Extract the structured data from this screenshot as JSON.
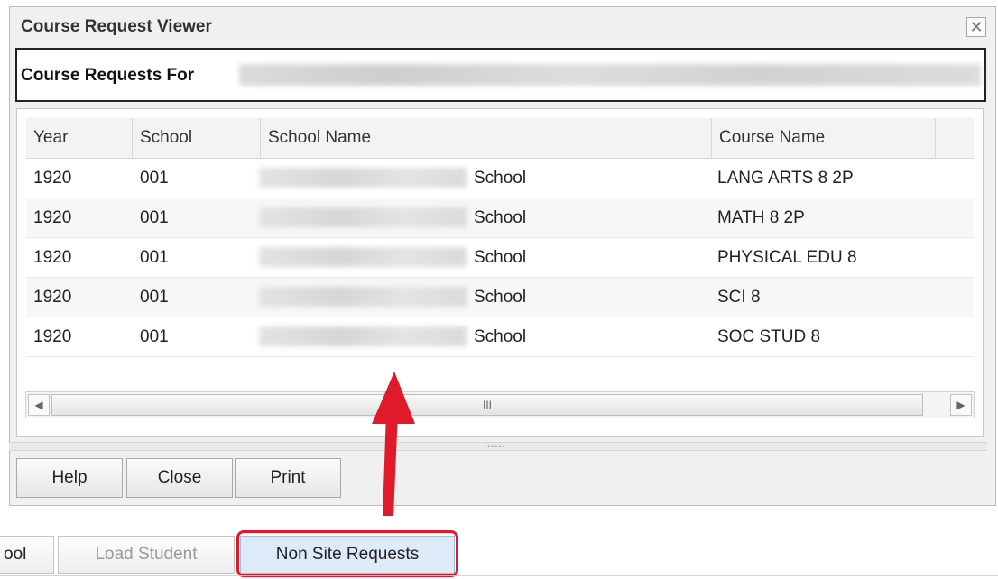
{
  "dialog": {
    "title": "Course Request Viewer",
    "close_glyph": "✕",
    "requests_for_label": "Course Requests For",
    "table": {
      "columns": [
        "Year",
        "School",
        "School Name",
        "Course Name"
      ],
      "rows": [
        {
          "year": "1920",
          "school": "001",
          "school_name": "School",
          "course_name": "LANG ARTS 8 2P"
        },
        {
          "year": "1920",
          "school": "001",
          "school_name": "School",
          "course_name": "MATH 8 2P"
        },
        {
          "year": "1920",
          "school": "001",
          "school_name": "School",
          "course_name": "PHYSICAL EDU 8"
        },
        {
          "year": "1920",
          "school": "001",
          "school_name": "School",
          "course_name": "SCI 8"
        },
        {
          "year": "1920",
          "school": "001",
          "school_name": "School",
          "course_name": "SOC STUD 8"
        }
      ]
    },
    "scrollbar": {
      "left_arrow": "◀",
      "right_arrow": "▶",
      "thumb_grip": "III"
    },
    "splitter_grip": "•••••",
    "buttons": {
      "help": "Help",
      "close": "Close",
      "print": "Print"
    }
  },
  "toolbar": {
    "partial_left": "ool",
    "load_student": "Load Student",
    "non_site_requests": "Non Site Requests"
  },
  "colors": {
    "highlight": "#e11a2b",
    "arrow": "#e11a2b",
    "button_active_bg": "#dcebf7"
  }
}
